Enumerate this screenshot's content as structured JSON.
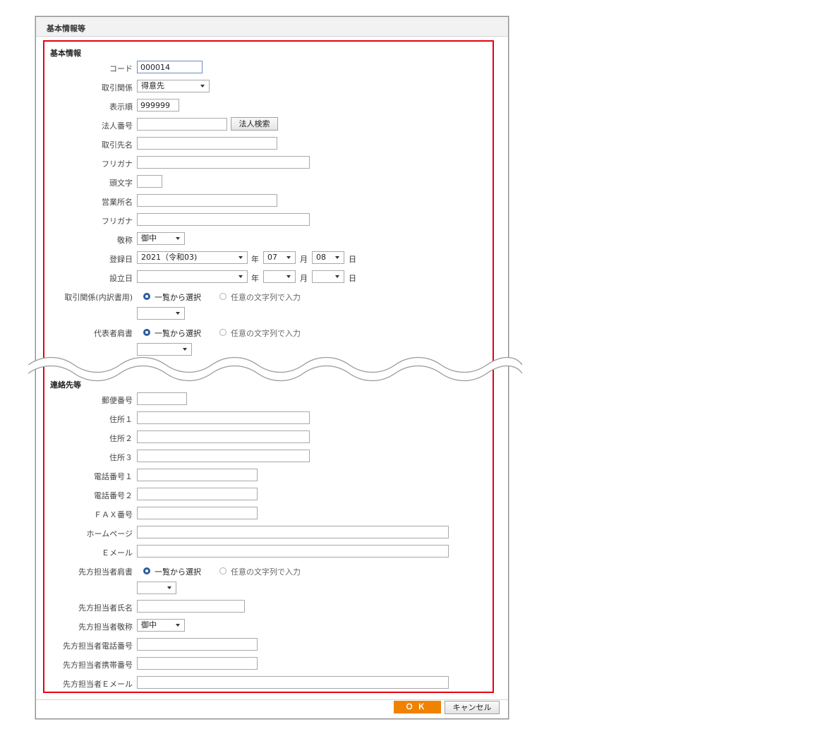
{
  "dialog": {
    "title": "基本情報等",
    "accent": "#f08200",
    "highlight": "#e60012"
  },
  "basic": {
    "section_title": "基本情報",
    "code": {
      "label": "コード",
      "value": "000014"
    },
    "relation": {
      "label": "取引関係",
      "value": "得意先"
    },
    "order": {
      "label": "表示順",
      "value": "999999"
    },
    "corp_no": {
      "label": "法人番号",
      "value": "",
      "search_button": "法人検索"
    },
    "name": {
      "label": "取引先名",
      "value": ""
    },
    "kana": {
      "label": "フリガナ",
      "value": ""
    },
    "initial": {
      "label": "頭文字",
      "value": ""
    },
    "office": {
      "label": "営業所名",
      "value": ""
    },
    "office_kana": {
      "label": "フリガナ",
      "value": ""
    },
    "honorific": {
      "label": "敬称",
      "value": "御中"
    },
    "reg_date": {
      "label": "登録日",
      "year": "2021（令和03)",
      "month": "07",
      "day": "08",
      "year_unit": "年",
      "month_unit": "月",
      "day_unit": "日"
    },
    "est_date": {
      "label": "設立日",
      "year": "",
      "month": "",
      "day": "",
      "year_unit": "年",
      "month_unit": "月",
      "day_unit": "日"
    },
    "relation_detail": {
      "label": "取引関係(内訳書用)",
      "opt1": "一覧から選択",
      "opt2": "任意の文字列で入力",
      "value": ""
    },
    "rep_title": {
      "label": "代表者肩書",
      "opt1": "一覧から選択",
      "opt2": "任意の文字列で入力",
      "value": ""
    }
  },
  "contact": {
    "section_title": "連絡先等",
    "zip": {
      "label": "郵便番号",
      "value": ""
    },
    "addr1": {
      "label": "住所１",
      "value": ""
    },
    "addr2": {
      "label": "住所２",
      "value": ""
    },
    "addr3": {
      "label": "住所３",
      "value": ""
    },
    "tel1": {
      "label": "電話番号１",
      "value": ""
    },
    "tel2": {
      "label": "電話番号２",
      "value": ""
    },
    "fax": {
      "label": "ＦＡＸ番号",
      "value": ""
    },
    "homepage": {
      "label": "ホームページ",
      "value": ""
    },
    "email": {
      "label": "Ｅメール",
      "value": ""
    },
    "pic_title": {
      "label": "先方担当者肩書",
      "opt1": "一覧から選択",
      "opt2": "任意の文字列で入力",
      "value": ""
    },
    "pic_name": {
      "label": "先方担当者氏名",
      "value": ""
    },
    "pic_honorific": {
      "label": "先方担当者敬称",
      "value": "御中"
    },
    "pic_tel": {
      "label": "先方担当者電話番号",
      "value": ""
    },
    "pic_mobile": {
      "label": "先方担当者携帯番号",
      "value": ""
    },
    "pic_email": {
      "label": "先方担当者Ｅメール",
      "value": ""
    }
  },
  "footer": {
    "ok": "ＯＫ",
    "cancel": "キャンセル"
  }
}
